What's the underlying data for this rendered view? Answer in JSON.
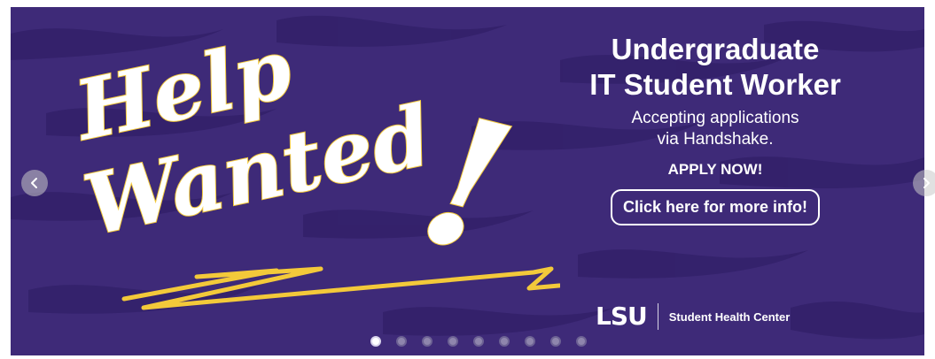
{
  "carousel": {
    "slide": {
      "art": {
        "word1": "Help",
        "word2": "Wanted",
        "exclamation": "!"
      },
      "headline_line1": "Undergraduate",
      "headline_line2": "IT Student Worker",
      "subline_line1": "Accepting applications",
      "subline_line2": "via Handshake.",
      "apply": "APPLY NOW!",
      "cta_label": "Click here for more info!",
      "brand_logo": "LSU",
      "brand_dept": "Student Health Center"
    },
    "prev_icon": "chevron-left-icon",
    "next_icon": "chevron-right-icon",
    "dots": {
      "count": 9,
      "active_index": 0
    },
    "colors": {
      "purple": "#3e2a78",
      "gold": "#f3c93a",
      "text": "#ffffff"
    }
  }
}
